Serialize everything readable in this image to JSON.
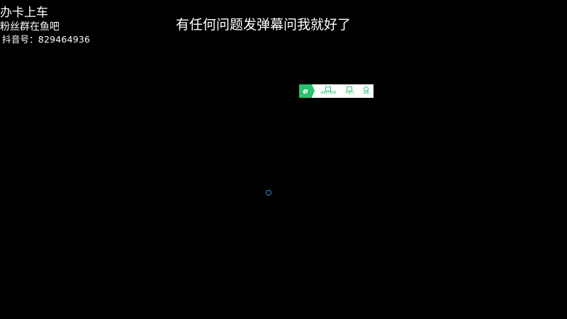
{
  "overlay": {
    "line1": "办卡上车",
    "line2": "粉丝群在鱼吧",
    "line3": "抖音号：829464936"
  },
  "caption": "有任何问题发弹幕问我就好了",
  "mini_toolbar": {
    "logo_letter": "e",
    "items": [
      {
        "label": "录制小视频",
        "icon": "video-record-icon"
      },
      {
        "label": "小窗口",
        "icon": "small-window-icon"
      },
      {
        "label": "设置",
        "icon": "gear-icon"
      }
    ],
    "accent_color": "#2bc16e"
  },
  "spinner": {
    "icon": "loading-spinner-icon",
    "color": "#3a8ee6"
  }
}
